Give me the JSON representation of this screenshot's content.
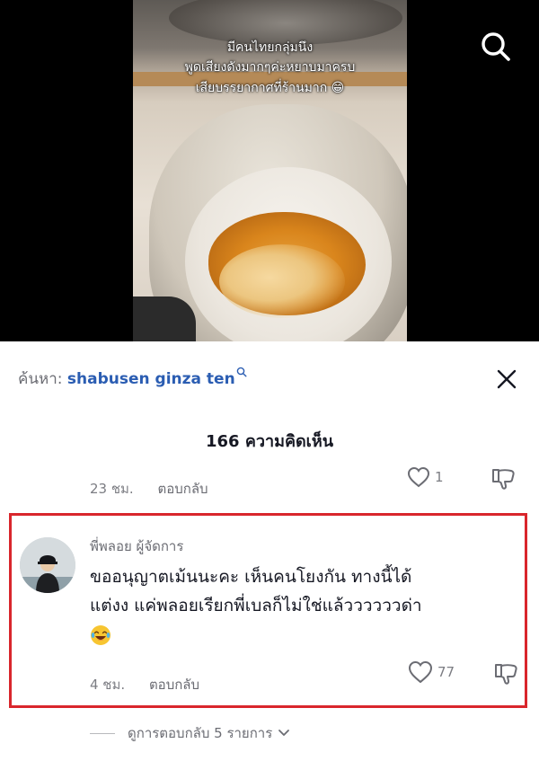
{
  "video": {
    "caption_line1": "มีคนไทยกลุ่มนึง",
    "caption_line2": "พูดเสียงดังมากๆค่ะหยาบมาครบ",
    "caption_line3": "เสียบรรยากาศที่ร้านมาก 😁"
  },
  "search_bar": {
    "prefix": "ค้นหา:",
    "query": "shabusen ginza ten"
  },
  "comments_header": {
    "count_label": "166 ความคิดเห็น"
  },
  "previous_comment": {
    "time": "23 ชม.",
    "reply_label": "ตอบกลับ",
    "likes": "1"
  },
  "highlighted_comment": {
    "username": "พี่พลอย ผู้จัดการ",
    "text_line1": "ขออนุญาตเม้นนะคะ เห็นคนโยงกัน ทางนี้ได้",
    "text_line2": "แต่งง แค่พลอยเรียกพี่เบลก็ไม่ใช่แล้ววววววด่า",
    "time": "4 ชม.",
    "reply_label": "ตอบกลับ",
    "likes": "77",
    "view_replies_label": "ดูการตอบกลับ 5 รายการ"
  },
  "colors": {
    "highlight_border": "#d9262c",
    "search_query": "#2b5db2",
    "muted_text": "#7c7d83"
  },
  "icons": [
    "search-icon",
    "close-icon",
    "heart-icon",
    "dislike-icon",
    "chevron-down-icon",
    "laughing-emoji-icon"
  ]
}
